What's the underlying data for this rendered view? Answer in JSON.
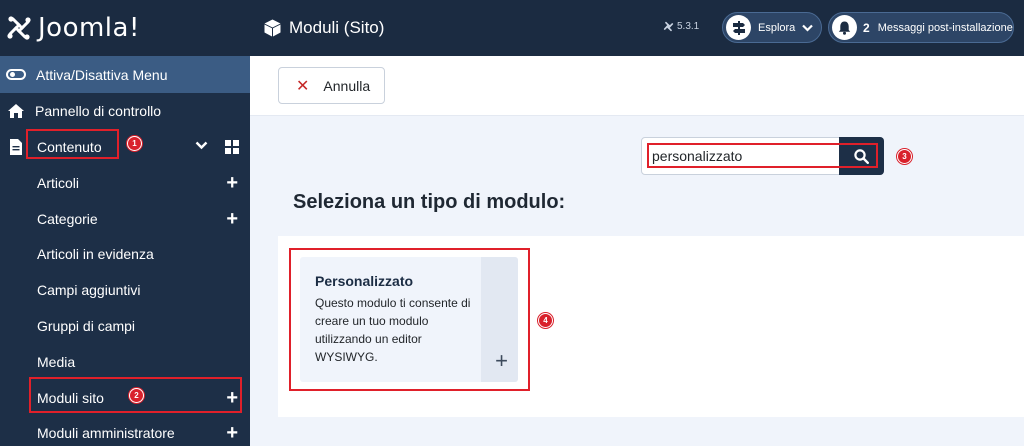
{
  "brand": {
    "name": "Joomla!"
  },
  "header": {
    "title": "Moduli (Sito)",
    "version": "5.3.1",
    "explore_label": "Esplora",
    "messages_count": "2",
    "messages_label": "Messaggi post-installazione"
  },
  "sidebar": {
    "toggle_label": "Attiva/Disattiva Menu",
    "dashboard_label": "Pannello di controllo",
    "content_label": "Contenuto",
    "items": [
      {
        "label": "Articoli"
      },
      {
        "label": "Categorie"
      },
      {
        "label": "Articoli in evidenza"
      },
      {
        "label": "Campi aggiuntivi"
      },
      {
        "label": "Gruppi di campi"
      },
      {
        "label": "Media"
      },
      {
        "label": "Moduli sito"
      },
      {
        "label": "Moduli amministratore"
      }
    ]
  },
  "toolbar": {
    "cancel_label": "Annulla"
  },
  "search": {
    "value": "personalizzato"
  },
  "main": {
    "section_title": "Seleziona un tipo di modulo:",
    "card": {
      "title": "Personalizzato",
      "description": "Questo modulo ti consente di creare un tuo modulo utilizzando un editor WYSIWYG."
    }
  },
  "annotations": [
    "1",
    "2",
    "3",
    "4"
  ],
  "colors": {
    "sidebar": "#1d2f47",
    "header": "#1b2b41",
    "toggle_row": "#3b5c84",
    "marker": "#e0202a"
  }
}
